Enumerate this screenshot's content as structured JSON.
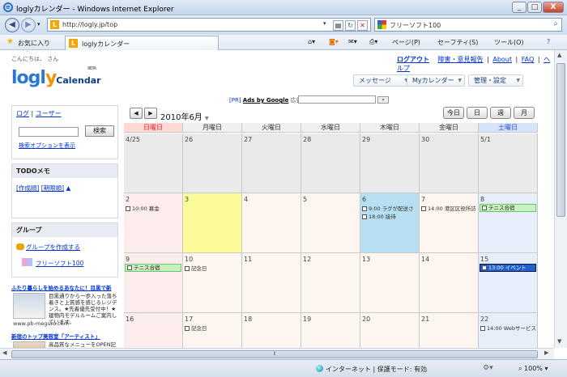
{
  "window": {
    "title": "loglyカレンダー - Windows Internet Explorer",
    "minimize": "_",
    "maximize": "□",
    "close": "X"
  },
  "address": {
    "url": "http://logly.jp/top",
    "search_text": "フリーソフト100"
  },
  "favorites": {
    "label": "お気に入り",
    "tab_label": "loglyカレンダー"
  },
  "toolbar": {
    "page": "ページ(P)",
    "safety": "セーフティ(S)",
    "tools": "ツール(O)",
    "help": "?"
  },
  "site": {
    "greeting": "こんにちは、            さん",
    "logout": "ログアウト",
    "feedback": "障害・意見報告",
    "about": "About",
    "faq": "FAQ",
    "help": "ヘルプ",
    "logo_main_a": "logl",
    "logo_main_y": "y",
    "logo_sub": "Calendar",
    "logo_beta": "BETA",
    "menu": {
      "message": "メッセージ",
      "mycal": "Myカレンダー",
      "admin": "管理・設定"
    },
    "ads": {
      "pr": "[PR]",
      "google": "Ads by Google",
      "search_label": "広告検索"
    }
  },
  "sidebar": {
    "tab_log": "ログ",
    "tab_sep": "|",
    "tab_user": "ユーザー",
    "search_button": "検索",
    "search_options": "検索オプションを表示",
    "todo_title": "TODOメモ",
    "todo_created": "[作成順]",
    "todo_deadline": "[期限順]",
    "todo_arrow": "▲",
    "group_title": "グループ",
    "group_create": "グループを作成する",
    "group_item": "フリーソフト100",
    "ad1_title": "ふたり暮らしを始めるあなたに！目黒で新",
    "ad1_body": "目黒通りから一歩入った落ち着きと上質感を感じるレジデンス。★先着優先受付中！★建物内モデルルームご案内しています。",
    "ad1_url": "www.pb-meguro.com",
    "ad2_title": "新宿のトップ美容室「アーティスト」",
    "ad2_body": "高品質なメニューをOPEN記念価格にてご提供"
  },
  "calendar": {
    "month_label": "2010年6月",
    "nav_prev": "◀",
    "nav_next": "▶",
    "view_today": "今日",
    "view_day": "日",
    "view_week": "週",
    "view_month": "月",
    "weekdays": [
      "日曜日",
      "月曜日",
      "火曜日",
      "水曜日",
      "木曜日",
      "金曜日",
      "土曜日"
    ],
    "weeks": [
      [
        "4/25",
        "26",
        "27",
        "28",
        "29",
        "30",
        "5/1"
      ],
      [
        "2",
        "3",
        "4",
        "5",
        "6",
        "7",
        "8"
      ],
      [
        "9",
        "10",
        "11",
        "12",
        "13",
        "14",
        "15"
      ],
      [
        "16",
        "17",
        "18",
        "19",
        "20",
        "21",
        "22"
      ]
    ],
    "events": {
      "e1": "10:00 募金",
      "e2": "9:00 ラグが配送さ",
      "e3": "18:00 接待",
      "e4": "14:00 港区区役所訪",
      "e5": "テニス合宿",
      "e6": "テニス合宿",
      "e7": "記念日",
      "e8": "13:00 イベント",
      "e9": "記念日",
      "e10": "14:00 Webサービス"
    }
  },
  "status": {
    "zone": "インターネット | 保護モード: 有効",
    "zoom": "100%"
  }
}
